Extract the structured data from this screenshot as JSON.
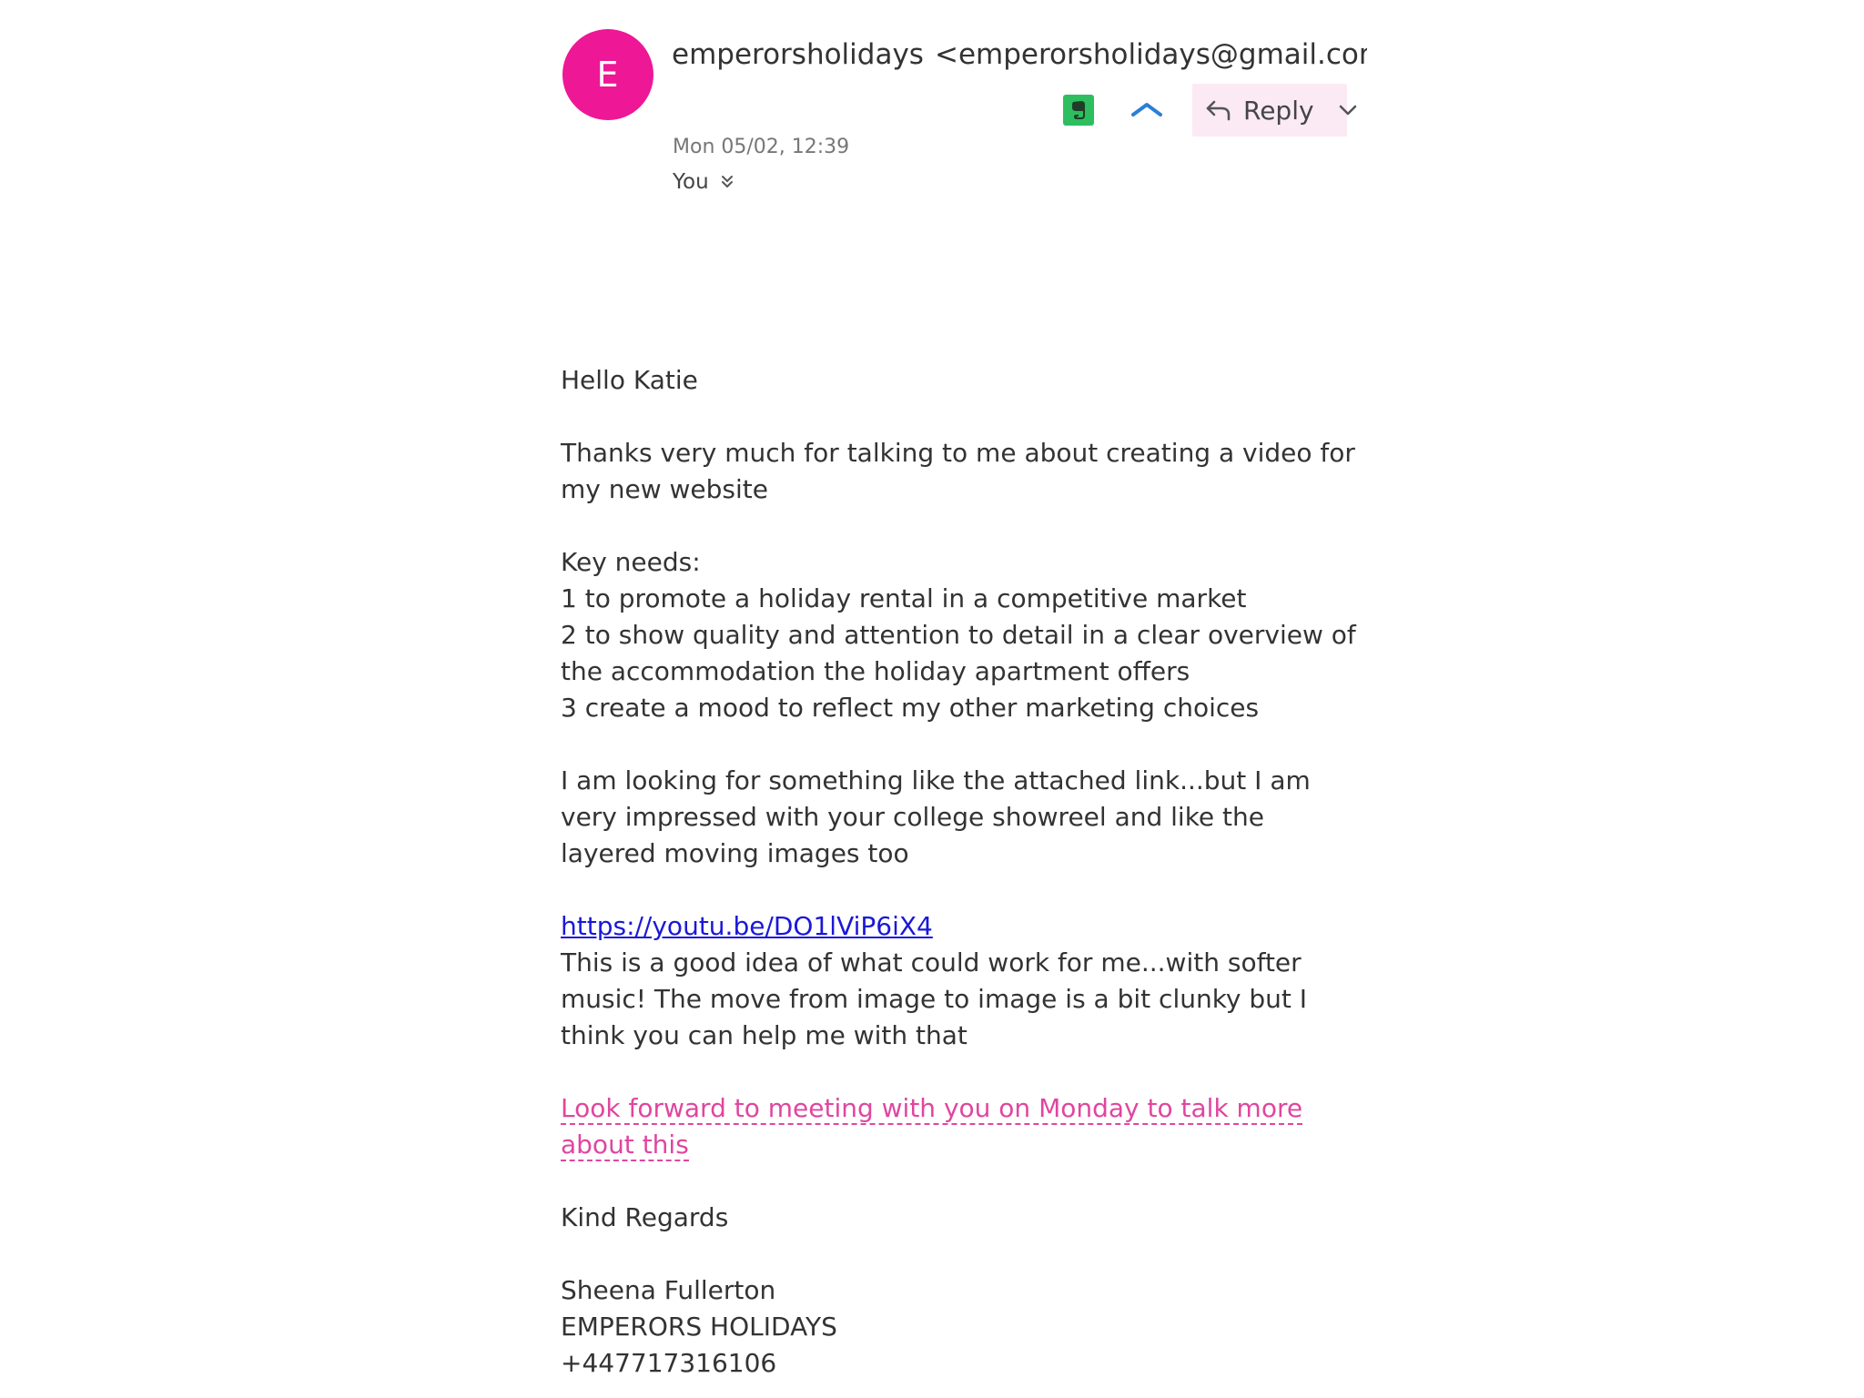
{
  "sender": {
    "avatar_letter": "E",
    "avatar_color": "#ee1796",
    "name": "emperorsholidays",
    "email": "<emperorsholidays@gmail.com>",
    "date": "Mon 05/02, 12:39",
    "recipient": "You"
  },
  "toolbar": {
    "evernote_icon": "evernote-icon",
    "expand_icon": "chevron-up-icon",
    "reply_label": "Reply",
    "reply_dropdown_icon": "chevron-down-icon"
  },
  "message": {
    "greeting": "Hello Katie",
    "para1": "Thanks very much for talking to me about creating a video for my new website",
    "key_needs_title": "Key needs:",
    "need1": "1 to promote a holiday rental in a competitive market",
    "need2": "2 to show quality and attention to detail in a clear overview of the accommodation the holiday apartment offers",
    "need3": "3 create a mood to reflect my other marketing choices",
    "para2": "I am looking for something like the attached link...but I am very impressed with your college showreel and like the layered moving images too",
    "link": "https://youtu.be/DO1lViP6iX4",
    "link_comment": "This is a good idea of what could work for me...with softer music! The move from image to image is a bit clunky but I think you can help me with that",
    "meeting": "Look forward to meeting with you on Monday to talk more about this",
    "closing": "Kind Regards",
    "sig_name": "Sheena Fullerton",
    "sig_company": "EMPERORS HOLIDAYS",
    "sig_phone": "+447717316106"
  },
  "colors": {
    "link": "#1a18d8",
    "highlight": "#e0469f",
    "reply_bg": "#fbeaf4"
  }
}
